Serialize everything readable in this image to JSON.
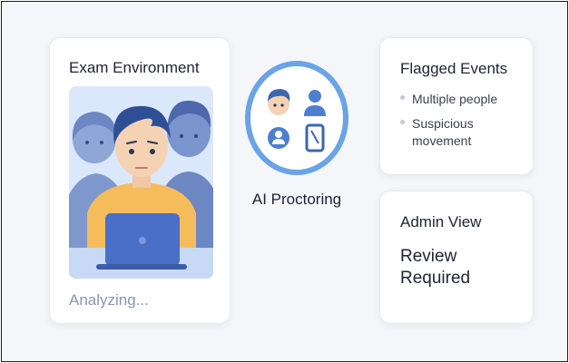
{
  "exam": {
    "title": "Exam Environment",
    "status": "Analyzing...",
    "illustration_icon": "student-at-laptop-illustration"
  },
  "proctoring": {
    "label": "AI Proctoring",
    "icons": [
      "person-face-icon",
      "user-silhouette-icon",
      "user-badge-icon",
      "phone-icon"
    ]
  },
  "flagged": {
    "title": "Flagged Events",
    "events": [
      {
        "label": "Multiple people"
      },
      {
        "label": "Suspicious movement"
      }
    ]
  },
  "admin": {
    "title": "Admin View",
    "status": "Review Required"
  },
  "colors": {
    "accent_blue": "#6aa3e6",
    "illustration_bg": "#dbe8fb",
    "person_blue": "#6c87c2",
    "shirt_yellow": "#f4bc5b",
    "hair_navy": "#2f4f95",
    "laptop": "#4a6fc6",
    "muted_text": "#8a97ad"
  }
}
